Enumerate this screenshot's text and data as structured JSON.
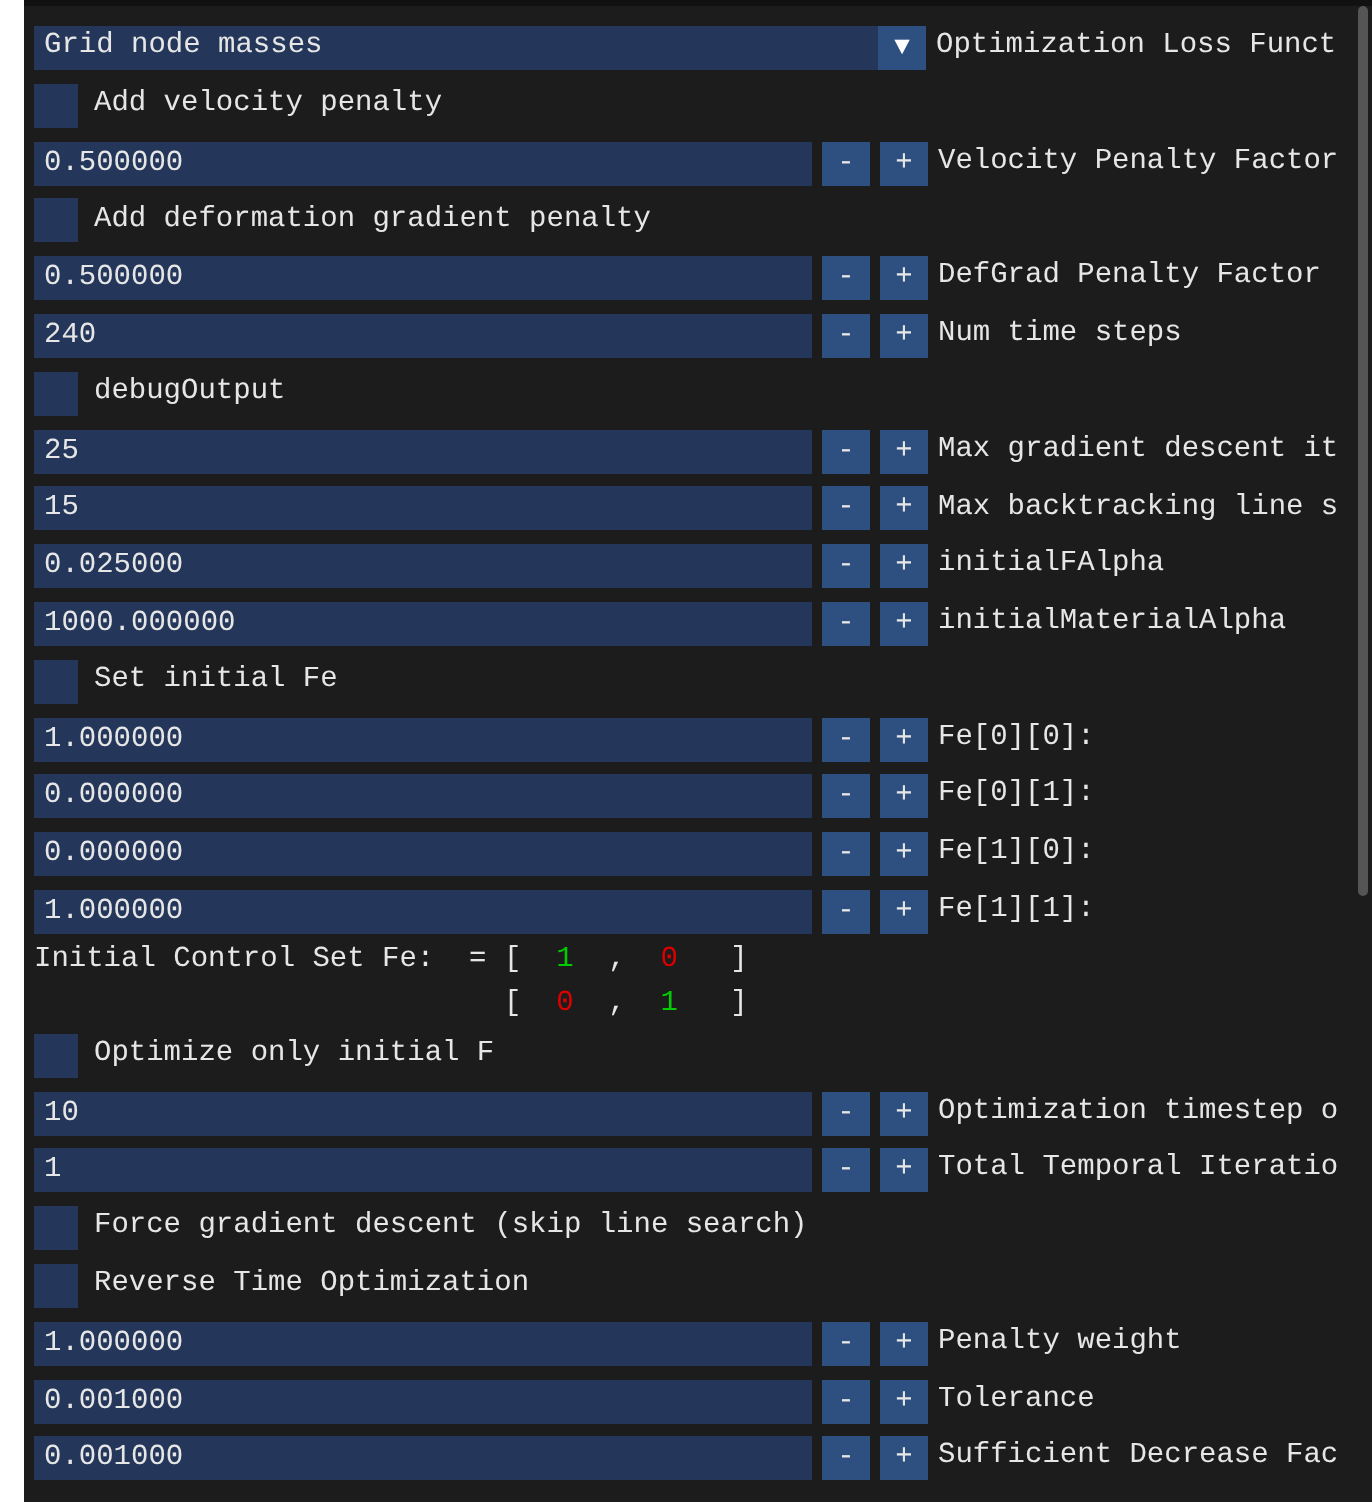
{
  "rows": [
    {
      "kind": "combo",
      "value": "Grid node masses",
      "arrow": "▼",
      "label": "Optimization Loss Funct"
    },
    {
      "kind": "checkbox",
      "text": "Add velocity penalty",
      "checked": false
    },
    {
      "kind": "input",
      "value": "0.500000",
      "minus": "-",
      "plus": "+",
      "label": "Velocity Penalty Factor"
    },
    {
      "kind": "checkbox",
      "text": "Add deformation gradient penalty",
      "checked": false
    },
    {
      "kind": "input",
      "value": "0.500000",
      "minus": "-",
      "plus": "+",
      "label": "DefGrad Penalty Factor"
    },
    {
      "kind": "input",
      "value": "240",
      "minus": "-",
      "plus": "+",
      "label": "Num time steps"
    },
    {
      "kind": "checkbox",
      "text": "debugOutput",
      "checked": false
    },
    {
      "kind": "input",
      "value": "25",
      "minus": "-",
      "plus": "+",
      "label": "Max gradient descent it"
    },
    {
      "kind": "input",
      "value": "15",
      "minus": "-",
      "plus": "+",
      "label": "Max backtracking line s"
    },
    {
      "kind": "input",
      "value": "0.025000",
      "minus": "-",
      "plus": "+",
      "label": "initialFAlpha"
    },
    {
      "kind": "input",
      "value": "1000.000000",
      "minus": "-",
      "plus": "+",
      "label": "initialMaterialAlpha"
    },
    {
      "kind": "checkbox",
      "text": "Set initial Fe",
      "checked": false
    },
    {
      "kind": "input",
      "value": "1.000000",
      "minus": "-",
      "plus": "+",
      "label": "Fe[0][0]:"
    },
    {
      "kind": "input",
      "value": "0.000000",
      "minus": "-",
      "plus": "+",
      "label": "Fe[0][1]:"
    },
    {
      "kind": "input",
      "value": "0.000000",
      "minus": "-",
      "plus": "+",
      "label": "Fe[1][0]:"
    },
    {
      "kind": "input",
      "value": "1.000000",
      "minus": "-",
      "plus": "+",
      "label": "Fe[1][1]:"
    },
    {
      "kind": "matrix",
      "caption": "Initial Control Set Fe:",
      "equals": "=",
      "lines": [
        {
          "open": "[",
          "sep": ",",
          "close": "]",
          "cells": [
            {
              "text": "1",
              "color": "#00cc00"
            },
            {
              "text": "0",
              "color": "#dd0000"
            }
          ]
        },
        {
          "open": "[",
          "sep": ",",
          "close": "]",
          "cells": [
            {
              "text": "0",
              "color": "#dd0000"
            },
            {
              "text": "1",
              "color": "#00cc00"
            }
          ]
        }
      ]
    },
    {
      "kind": "checkbox",
      "text": "Optimize only initial F",
      "checked": false
    },
    {
      "kind": "input",
      "value": "10",
      "minus": "-",
      "plus": "+",
      "label": "Optimization timestep o"
    },
    {
      "kind": "input",
      "value": "1",
      "minus": "-",
      "plus": "+",
      "label": "Total Temporal Iteratio"
    },
    {
      "kind": "checkbox",
      "text": "Force gradient descent (skip line search)",
      "checked": false
    },
    {
      "kind": "checkbox",
      "text": "Reverse Time Optimization",
      "checked": false
    },
    {
      "kind": "input",
      "value": "1.000000",
      "minus": "-",
      "plus": "+",
      "label": "Penalty weight"
    },
    {
      "kind": "input",
      "value": "0.001000",
      "minus": "-",
      "plus": "+",
      "label": "Tolerance"
    },
    {
      "kind": "input",
      "value": "0.001000",
      "minus": "-",
      "plus": "+",
      "label": "Sufficient Decrease Fac"
    }
  ]
}
